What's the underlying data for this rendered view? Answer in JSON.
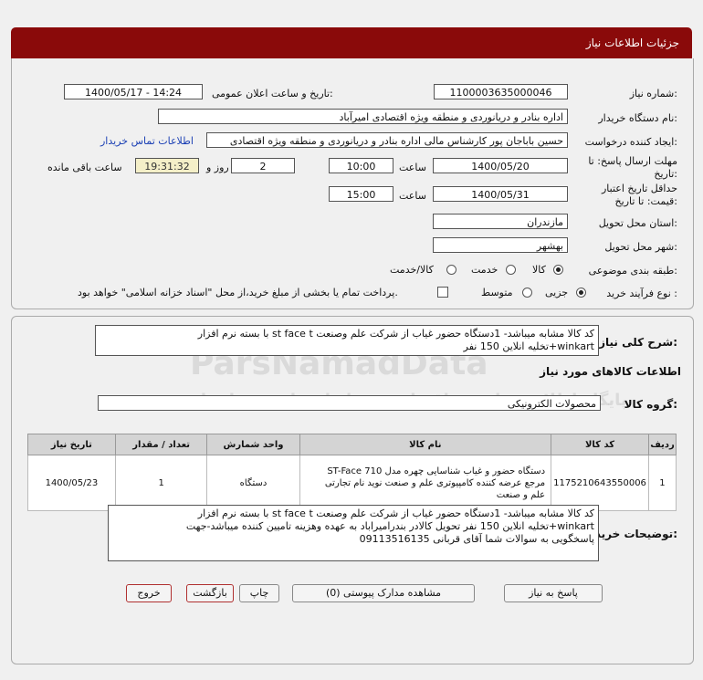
{
  "header": {
    "title": "جزئیات اطلاعات نیاز"
  },
  "form": {
    "need_number_label": "شماره نیاز:",
    "need_number": "1100003635000046",
    "announce_label": "تاریخ و ساعت اعلان عمومی:",
    "announce_value": "1400/05/17 - 14:24",
    "buyer_label": "نام دستگاه خریدار:",
    "buyer_value": "اداره بنادر و دریانوردی و منطقه ویژه اقتصادی امیرآباد",
    "creator_label": "ایجاد کننده درخواست:",
    "creator_value": "حسین باباجان پور کارشناس مالی اداره بنادر و دریانوردی و منطقه ویژه اقتصادی",
    "contact_link": "اطلاعات تماس خریدار",
    "deadline_label_1": "مهلت ارسال پاسخ: تا",
    "deadline_label_2": "تاریخ:",
    "deadline_date": "1400/05/20",
    "time_label": "ساعت",
    "deadline_time": "10:00",
    "days_value": "2",
    "days_label": "روز و",
    "remaining_value": "19:31:32",
    "remaining_label": "ساعت باقی مانده",
    "validity_label_1": "حداقل تاریخ اعتبار",
    "validity_label_2": "قیمت: تا تاریخ:",
    "validity_date": "1400/05/31",
    "validity_time_label": "ساعت",
    "validity_time": "15:00",
    "province_label": "استان محل تحویل:",
    "province_value": "مازندران",
    "city_label": "شهر محل تحویل:",
    "city_value": "بهشهر",
    "category_label": "طبقه بندی موضوعی:",
    "category_options": [
      "کالا",
      "خدمت",
      "کالا/خدمت"
    ],
    "process_label": "نوع فرآیند خرید :",
    "process_options": [
      "جزیی",
      "متوسط"
    ],
    "payment_note": "پرداخت تمام یا بخشی از مبلغ خرید،از محل \"اسناد خزانه اسلامی\" خواهد بود."
  },
  "details": {
    "summary_label": "شرح کلی نیاز:",
    "summary_line1": "کد کالا مشابه میباشد- 1دستگاه حضور غیاب از شرکت علم وصنعت st face t با بسته نرم افزار",
    "summary_line2": "winkart+تخلیه انلاین 150 نفر",
    "goods_info_title": "اطلاعات کالاهای مورد نیاز",
    "group_label": "گروه کالا:",
    "group_value": "محصولات الکترونیکی",
    "table_headers": [
      "ردیف",
      "کد کالا",
      "نام کالا",
      "واحد شمارش",
      "تعداد / مقدار",
      "تاریخ نیاز"
    ],
    "rows": [
      {
        "index": "1",
        "code": "1175210643550006",
        "name_line1": "دستگاه حضور و غیاب شناسایی چهره مدل ST-Face 710",
        "name_line2": "مرجع عرضه کننده کامپیوتری علم و صنعت نوید نام تجارتی",
        "name_line3": "علم و صنعت",
        "unit": "دستگاه",
        "qty": "1",
        "date": "1400/05/23"
      }
    ],
    "desc_label": "توضیحات خریدار:",
    "desc_line1": "کد کالا مشابه میباشد- 1دستگاه حضور غیاب از شرکت علم وصنعت st face t با بسته نرم افزار",
    "desc_line2": "winkart+تخلیه انلاین 150 نفر تحویل کالادر بندرامیراباد به عهده وهزینه تامیین کننده میباشد-جهت",
    "desc_line3": "پاسخگویی به سوالات شما آقای قربانی 09113516135"
  },
  "buttons": {
    "reply": "پاسخ به نیاز",
    "view_docs": "مشاهده مدارک پیوستی (0)",
    "print": "چاپ",
    "back": "بازگشت",
    "exit": "خروج"
  },
  "watermark": {
    "line1": "ParsNamadData",
    "line2": "پایگاه اطلاع رسانی مناقصات و مزایدات پارس نماد داده"
  },
  "colors": {
    "header_bg": "#8a0a0a",
    "link": "#1a3fb4"
  }
}
